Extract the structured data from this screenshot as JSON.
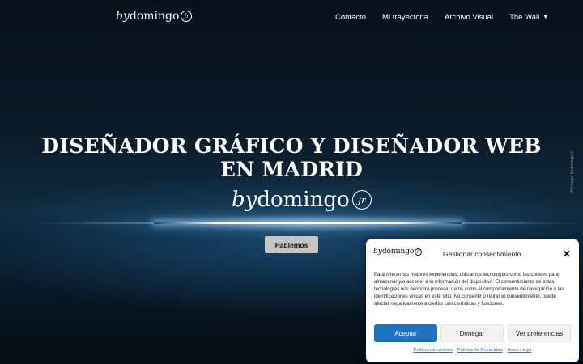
{
  "header": {
    "logo": {
      "by": "by",
      "name": "domingo",
      "jr": "Jr"
    },
    "nav": [
      {
        "label": "Contacto"
      },
      {
        "label": "Mi trayectoria"
      },
      {
        "label": "Archivo Visual"
      },
      {
        "label": "The Wall",
        "icon": "chevron-down-icon"
      }
    ]
  },
  "hero": {
    "title": "DISEÑADOR GRÁFICO Y DISEÑADOR WEB EN MADRID",
    "logo": {
      "by": "by",
      "name": "domingo",
      "jr": "Jr"
    },
    "cta_label": "Hablemos",
    "side_credit": "AI Image: bydomingoJr"
  },
  "consent": {
    "logo": {
      "by": "by",
      "name": "domingo",
      "jr": "Jr"
    },
    "title": "Gestionar consentimiento",
    "close_icon": "close-icon",
    "text": "Para ofrecer las mejores experiencias, utilizamos tecnologías como las cookies para almacenar y/o acceder a la información del dispositivo. El consentimiento de estas tecnologías nos permitirá procesar datos como el comportamiento de navegación o las identificaciones únicas en este sitio. No consentir o retirar el consentimiento, puede afectar negativamente a ciertas características y funciones.",
    "buttons": {
      "accept": "Aceptar",
      "deny": "Denegar",
      "prefs": "Ver preferencias"
    },
    "links": [
      "Política de cookies",
      "Política de Privacidad",
      "Aviso Legal"
    ],
    "colors": {
      "accent": "#1e73be"
    }
  }
}
